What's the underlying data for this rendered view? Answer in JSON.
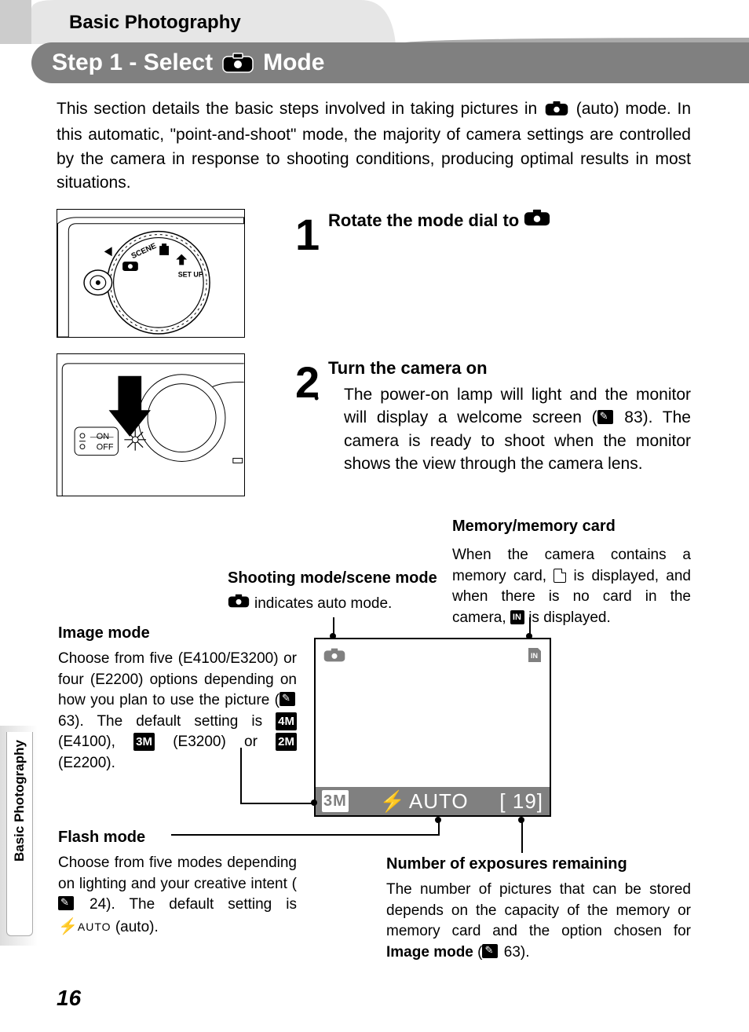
{
  "header": {
    "tab": "Basic Photography",
    "step_prefix": "Step 1 - Select",
    "step_suffix": "Mode"
  },
  "intro": {
    "p1a": "This section details the basic steps involved in taking pictures in ",
    "p1b": " (auto) mode. In this automatic, \"point-and-shoot\" mode, the majority of camera settings are controlled by the camera in response to shooting conditions, producing optimal results in most situations."
  },
  "steps": {
    "s1_num": "1",
    "s1_title": "Rotate the mode dial to ",
    "s2_num": "2",
    "s2_title": "Turn the camera on",
    "s2_body_a": "The power-on lamp will light and the monitor will display a welcome screen (",
    "s2_body_ref": " 83",
    "s2_body_b": "). The camera is ready to shoot when the monitor shows the view through the camera lens."
  },
  "labels": {
    "memory_title": "Memory/memory card",
    "memory_body_a": "When the camera contains a memory card, ",
    "memory_body_b": " is displayed, and when there is no card in the camera, ",
    "memory_body_c": " is displayed.",
    "shooting_title": "Shooting mode/scene mode",
    "shooting_body": "indicates auto mode.",
    "image_title": "Image mode",
    "image_body_a": "Choose from five (E4100/E3200) or four (E2200) options depending on how you plan to use the picture (",
    "image_ref": " 63",
    "image_body_b": "). The default setting is ",
    "image_badge1": "4M",
    "image_body_c": " (E4100), ",
    "image_badge2": "3M",
    "image_body_d": " (E3200) or ",
    "image_badge3": "2M",
    "image_body_e": " (E2200).",
    "flash_title": "Flash mode",
    "flash_body_a": "Choose from five modes depending on lighting and your creative intent (",
    "flash_ref": " 24",
    "flash_body_b": "). The default setting is ",
    "flash_auto": "AUTO",
    "flash_body_c": " (auto).",
    "exp_title": "Number of exposures remaining",
    "exp_body_a": "The number of pictures that can be stored depends on the capacity of the memory or memory card and the option chosen for ",
    "exp_bold": "Image mode",
    "exp_body_b": " (",
    "exp_ref": " 63",
    "exp_body_c": ")."
  },
  "lcd": {
    "image_mode": "3M",
    "flash": "AUTO",
    "remaining": "[  19]"
  },
  "illus": {
    "dial_text_scene": "SCENE",
    "dial_text_setup": "SET UP",
    "power_on": "ON",
    "power_off": "OFF"
  },
  "side_tab": "Basic Photography",
  "page_number": "16"
}
